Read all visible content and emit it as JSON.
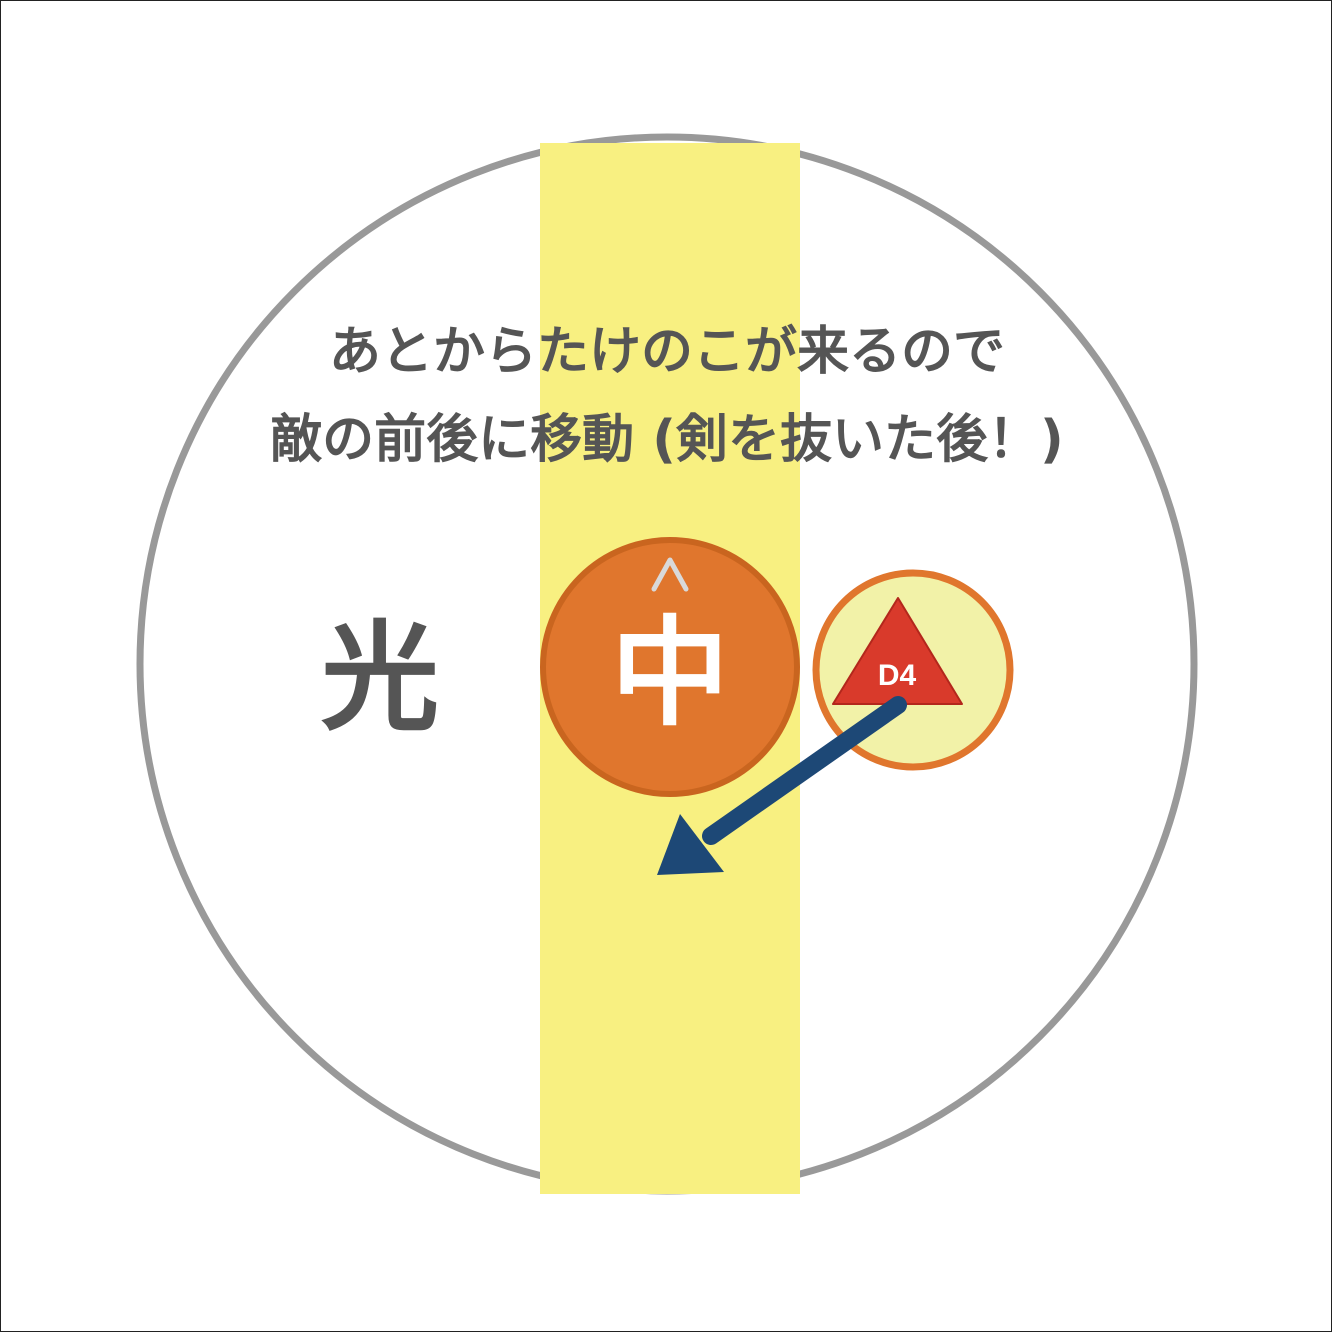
{
  "instruction": {
    "line1": "あとからたけのこが来るので",
    "line2": "敵の前後に移動 (剣を抜いた後！)"
  },
  "markers": {
    "light_label": "光",
    "center_player": {
      "label": "中",
      "facing_mark": "^"
    },
    "enemy": {
      "label": "D4"
    }
  },
  "colors": {
    "arena_ring": "#999999",
    "safe_strip": "#f8f081",
    "player_fill": "#e0762d",
    "player_border": "#c9651f",
    "enemy_disc_fill": "#f2f2a8",
    "enemy_disc_border": "#e0762d",
    "enemy_triangle": "#d93a2b",
    "arrow": "#1d4876",
    "text": "#555555"
  },
  "icons": {
    "player": "player-circle-icon",
    "enemy": "enemy-triangle-icon",
    "move": "move-arrow-icon"
  }
}
